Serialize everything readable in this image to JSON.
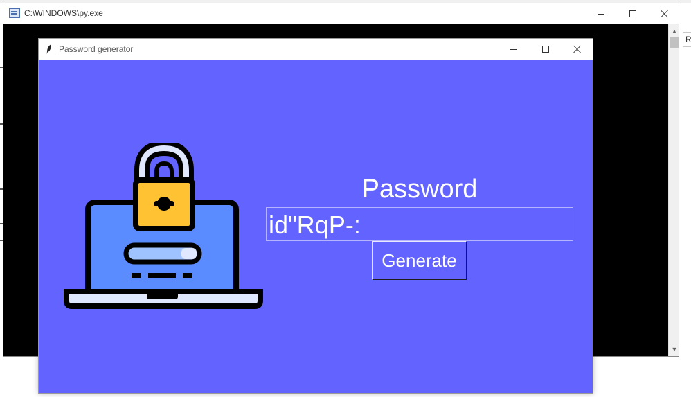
{
  "console": {
    "title": "C:\\WINDOWS\\py.exe",
    "icon": "console-icon"
  },
  "background": {
    "right_label": "R"
  },
  "app": {
    "title": "Password generator",
    "icon": "feather-icon",
    "label": "Password",
    "password_value": "id\"RqP-:",
    "generate_label": "Generate",
    "colors": {
      "background": "#6363ff",
      "laptop_screen": "#5a8cff",
      "lock_body": "#ffc233",
      "outline": "#000000"
    },
    "illustration": "laptop-lock-illustration"
  },
  "window_controls": {
    "minimize": "minimize-icon",
    "maximize": "maximize-icon",
    "close": "close-icon"
  }
}
